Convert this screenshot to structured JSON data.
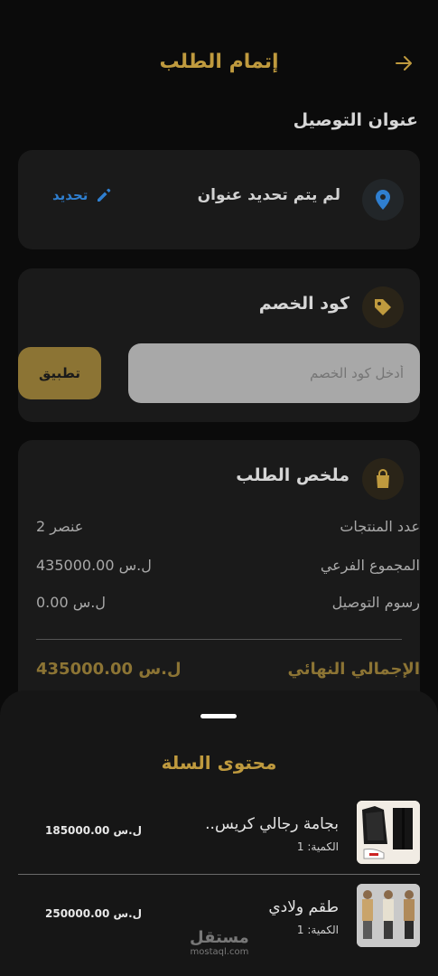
{
  "header": {
    "title": "إتمام الطلب"
  },
  "address": {
    "section_title": "عنوان التوصيل",
    "status": "لم يتم تحديد عنوان",
    "edit_label": "تحديد"
  },
  "discount": {
    "title": "كود الخصم",
    "placeholder": "أدخل كود الخصم",
    "apply_label": "تطبيق"
  },
  "summary": {
    "title": "ملخص الطلب",
    "rows": [
      {
        "label": "عدد المنتجات",
        "value": "2 عنصر"
      },
      {
        "label": "المجموع الفرعي",
        "value": "435000.00 ل.س"
      },
      {
        "label": "رسوم التوصيل",
        "value": "0.00 ل.س"
      }
    ],
    "total_label": "الإجمالي النهائي",
    "total_value": "435000.00 ل.س"
  },
  "cart": {
    "title": "محتوى السلة",
    "items": [
      {
        "name": "بجامة رجالي كريس..",
        "qty": "الكمية: 1",
        "price": "185000.00 ل.س"
      },
      {
        "name": "طقم ولادي",
        "qty": "الكمية: 1",
        "price": "250000.00 ل.س"
      }
    ]
  },
  "watermark": {
    "brand": "مستقل",
    "domain": "mostaql.com"
  },
  "colors": {
    "accent": "#bf9a3e",
    "link": "#2f7fd0",
    "background": "#0b0b0b",
    "card": "#1a1a1a"
  }
}
